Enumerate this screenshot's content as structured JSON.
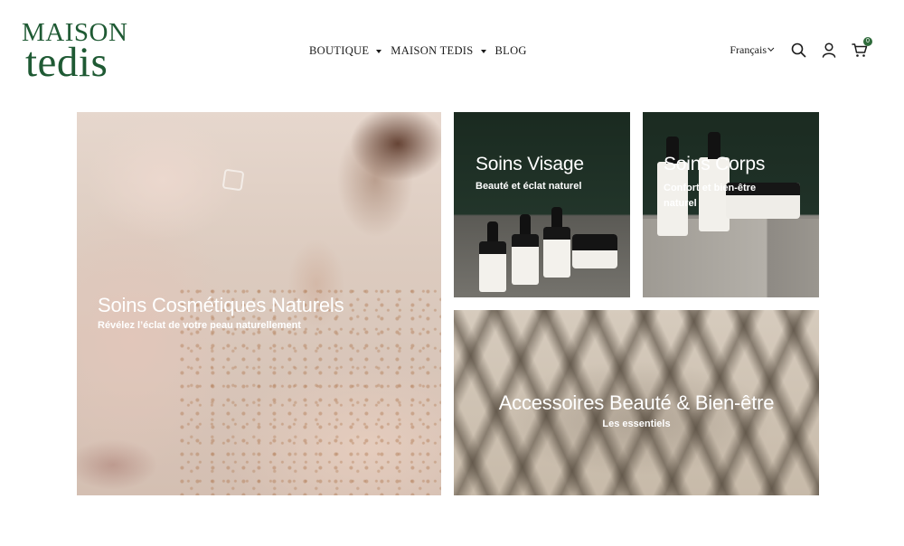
{
  "header": {
    "logo_top": "MAISON",
    "logo_bottom": "tedis",
    "nav": [
      {
        "label": "BOUTIQUE",
        "has_dropdown": true
      },
      {
        "label": "MAISON TEDIS",
        "has_dropdown": true
      },
      {
        "label": "BLOG",
        "has_dropdown": false
      }
    ],
    "language": "Français",
    "cart_count": "0",
    "icons": [
      "search-icon",
      "account-icon",
      "cart-icon"
    ],
    "brand_color": "#1f5a34"
  },
  "tiles": [
    {
      "title": "Soins Cosmétiques Naturels",
      "subtitle": "Révélez l’éclat de votre peau naturellement"
    },
    {
      "title": "Soins Visage",
      "subtitle": "Beauté et éclat naturel"
    },
    {
      "title": "Soins Corps",
      "subtitle": "Confort et bien-être naturel"
    },
    {
      "title": "Accessoires Beauté & Bien-être",
      "subtitle": "Les essentiels"
    }
  ]
}
